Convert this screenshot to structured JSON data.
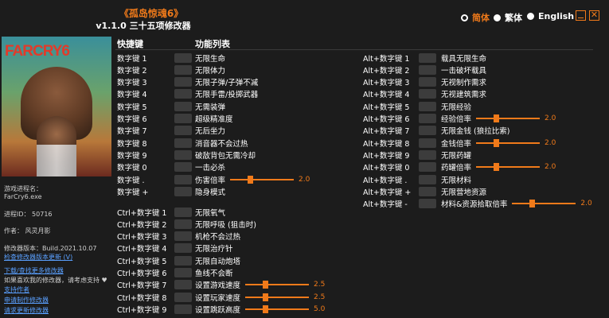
{
  "header": {
    "title": "《孤岛惊魂6》",
    "subtitle": "v1.1.0 三十五项修改器",
    "languages": [
      {
        "label": "简体",
        "active": true
      },
      {
        "label": "繁体",
        "active": false
      },
      {
        "label": "English",
        "active": false
      }
    ]
  },
  "cover": {
    "logo_main": "FARCRY",
    "logo_num": "6"
  },
  "sidebar": {
    "process_label": "游戏进程名：",
    "process_name": "FarCry6.exe",
    "pid": "进程ID： 50716",
    "author": "作者： 风灵月影",
    "version": "修改器版本：Build.2021.10.07",
    "links": [
      "检查修改器版本更新 (V)",
      "下载/查找更多修改器",
      "支持作者",
      "申请制作修改器",
      "请求更新修改器"
    ],
    "donate_text": "如果喜欢我的修改器，请考虑支持 ♥"
  },
  "columns": {
    "hotkey": "快捷键",
    "functions": "功能列表"
  },
  "left_rows": [
    {
      "key": "数字键 1",
      "label": "无限生命"
    },
    {
      "key": "数字键 2",
      "label": "无限体力"
    },
    {
      "key": "数字键 3",
      "label": "无限子弹/子弹不减"
    },
    {
      "key": "数字键 4",
      "label": "无限手雷/投掷武器"
    },
    {
      "key": "数字键 5",
      "label": "无需装弹"
    },
    {
      "key": "数字键 6",
      "label": "超级精准度"
    },
    {
      "key": "数字键 7",
      "label": "无后坐力"
    },
    {
      "key": "数字键 8",
      "label": "消音器不会过热"
    },
    {
      "key": "数字键 9",
      "label": "破敌背包无需冷却"
    },
    {
      "key": "数字键 0",
      "label": "一击必杀"
    },
    {
      "key": "数字键 .",
      "label": "伤害倍率",
      "value": "2.0",
      "level": 0.3
    },
    {
      "key": "数字键 +",
      "label": "隐身模式"
    }
  ],
  "ctrl_rows": [
    {
      "key": "Ctrl+数字键 1",
      "label": "无限氧气"
    },
    {
      "key": "Ctrl+数字键 2",
      "label": "无限呼吸 (狙击时)"
    },
    {
      "key": "Ctrl+数字键 3",
      "label": "机枪不会过热"
    },
    {
      "key": "Ctrl+数字键 4",
      "label": "无限治疗针"
    },
    {
      "key": "Ctrl+数字键 5",
      "label": "无限自动炮塔"
    },
    {
      "key": "Ctrl+数字键 6",
      "label": "鱼线不会断"
    },
    {
      "key": "Ctrl+数字键 7",
      "label": "设置游戏速度",
      "value": "2.5",
      "level": 0.3
    },
    {
      "key": "Ctrl+数字键 8",
      "label": "设置玩家速度",
      "value": "2.5",
      "level": 0.3
    },
    {
      "key": "Ctrl+数字键 9",
      "label": "设置跳跃高度",
      "value": "5.0",
      "level": 0.3
    }
  ],
  "alt_rows": [
    {
      "key": "Alt+数字键 1",
      "label": "载具无限生命"
    },
    {
      "key": "Alt+数字键 2",
      "label": "一击破坏载具"
    },
    {
      "key": "Alt+数字键 3",
      "label": "无视制作需求"
    },
    {
      "key": "Alt+数字键 4",
      "label": "无视建筑需求"
    },
    {
      "key": "Alt+数字键 5",
      "label": "无限经验"
    },
    {
      "key": "Alt+数字键 6",
      "label": "经验倍率",
      "value": "2.0",
      "level": 0.3
    },
    {
      "key": "Alt+数字键 7",
      "label": "无限金钱 (狼拉比索)"
    },
    {
      "key": "Alt+数字键 8",
      "label": "金钱倍率",
      "value": "2.0",
      "level": 0.3
    },
    {
      "key": "Alt+数字键 9",
      "label": "无限药罐"
    },
    {
      "key": "Alt+数字键 0",
      "label": "药罐倍率",
      "value": "2.0",
      "level": 0.3
    },
    {
      "key": "Alt+数字键 .",
      "label": "无限材料"
    },
    {
      "key": "Alt+数字键 +",
      "label": "无限营地资源"
    },
    {
      "key": "Alt+数字键 -",
      "label": "材料&资源拾取倍率",
      "value": "2.0",
      "level": 0.3
    }
  ]
}
